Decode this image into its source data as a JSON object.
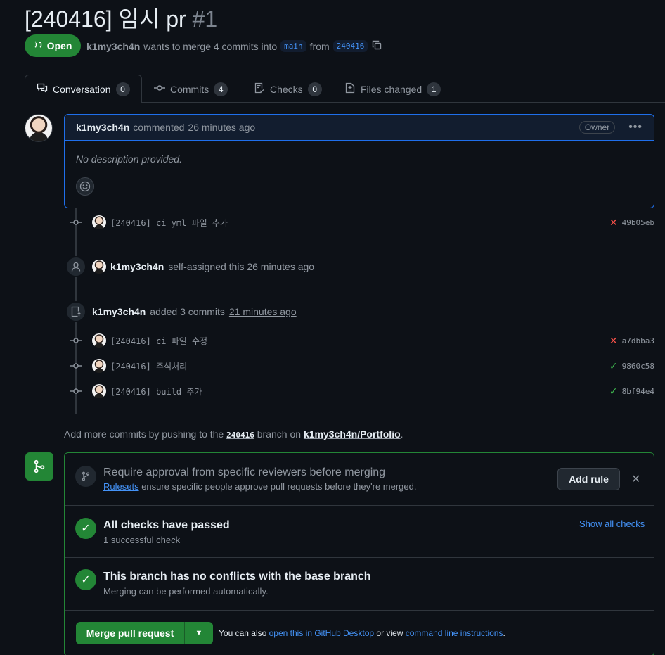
{
  "pr": {
    "title": "[240416] 임시 pr",
    "number": "#1",
    "state": "Open",
    "author": "k1my3ch4n",
    "meta_text": "wants to merge 4 commits into",
    "base_branch": "main",
    "from_text": "from",
    "head_branch": "240416"
  },
  "tabs": [
    {
      "label": "Conversation",
      "count": "0",
      "icon": "comment-discussion-icon"
    },
    {
      "label": "Commits",
      "count": "4",
      "icon": "git-commit-icon"
    },
    {
      "label": "Checks",
      "count": "0",
      "icon": "checklist-icon"
    },
    {
      "label": "Files changed",
      "count": "1",
      "icon": "file-diff-icon"
    }
  ],
  "comment": {
    "author": "k1my3ch4n",
    "action": "commented",
    "time": "26 minutes ago",
    "role": "Owner",
    "body": "No description provided."
  },
  "timeline": {
    "commit1": {
      "message": "[240416] ci yml 파일 추가",
      "sha": "49b05eb",
      "status": "fail"
    },
    "assign_event": {
      "actor": "k1my3ch4n",
      "text": "self-assigned this 26 minutes ago"
    },
    "push_event": {
      "actor": "k1my3ch4n",
      "text": "added 3 commits",
      "time": "21 minutes ago"
    },
    "commits": [
      {
        "message": "[240416] ci 파일 수정",
        "sha": "a7dbba3",
        "status": "fail"
      },
      {
        "message": "[240416] 주석처리",
        "sha": "9860c58",
        "status": "success"
      },
      {
        "message": "[240416] build 추가",
        "sha": "8bf94e4",
        "status": "success"
      }
    ]
  },
  "info": {
    "prefix": "Add more commits by pushing to the",
    "branch": "240416",
    "middle": "branch on",
    "repo": "k1my3ch4n/Portfolio",
    "suffix": "."
  },
  "merge": {
    "ruleset_title": "Require approval from specific reviewers before merging",
    "ruleset_link": "Rulesets",
    "ruleset_desc": "ensure specific people approve pull requests before they're merged.",
    "add_rule": "Add rule",
    "checks_title": "All checks have passed",
    "checks_sub": "1 successful check",
    "show_checks": "Show all checks",
    "conflict_title": "This branch has no conflicts with the base branch",
    "conflict_sub": "Merging can be performed automatically.",
    "merge_button": "Merge pull request",
    "note_prefix": "You can also",
    "note_link1": "open this in GitHub Desktop",
    "note_mid": "or view",
    "note_link2": "command line instructions",
    "note_suffix": "."
  },
  "colors": {
    "accent": "#4493f8",
    "success": "#238636",
    "danger": "#f85149",
    "bg": "#0d1117"
  }
}
